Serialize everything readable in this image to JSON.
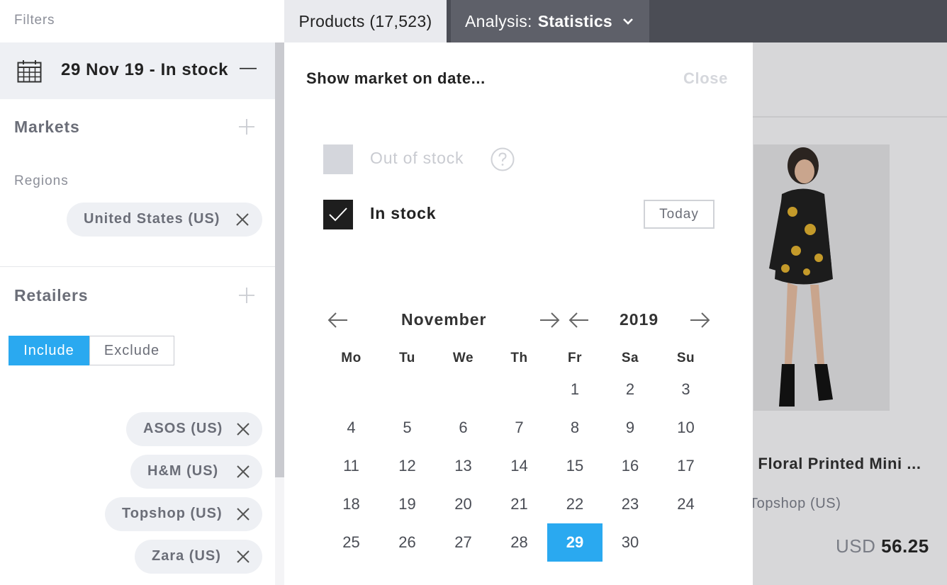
{
  "sidebar": {
    "filters_label": "Filters",
    "date_summary": "29 Nov 19 - In stock",
    "date_collapse": "—",
    "markets": {
      "title": "Markets",
      "regions_label": "Regions",
      "regions": [
        {
          "label": "United States (US)"
        }
      ]
    },
    "retailers": {
      "title": "Retailers",
      "include_label": "Include",
      "exclude_label": "Exclude",
      "mode": "Include",
      "items": [
        {
          "label": "ASOS (US)"
        },
        {
          "label": "H&M (US)"
        },
        {
          "label": "Topshop (US)"
        },
        {
          "label": "Zara (US)"
        }
      ]
    }
  },
  "topbar": {
    "products_tab": "Products (17,523)",
    "analysis_prefix": "Analysis:",
    "analysis_value": "Statistics"
  },
  "popup": {
    "title": "Show market on date...",
    "close_label": "Close",
    "out_of_stock": {
      "label": "Out of stock",
      "checked": false
    },
    "in_stock": {
      "label": "In stock",
      "checked": true
    },
    "today_label": "Today",
    "month": "November",
    "year": "2019",
    "weekdays": [
      "Mo",
      "Tu",
      "We",
      "Th",
      "Fr",
      "Sa",
      "Su"
    ],
    "weeks": [
      [
        "",
        "",
        "",
        "",
        "1",
        "2",
        "3"
      ],
      [
        "4",
        "5",
        "6",
        "7",
        "8",
        "9",
        "10"
      ],
      [
        "11",
        "12",
        "13",
        "14",
        "15",
        "16",
        "17"
      ],
      [
        "18",
        "19",
        "20",
        "21",
        "22",
        "23",
        "24"
      ],
      [
        "25",
        "26",
        "27",
        "28",
        "29",
        "30",
        ""
      ]
    ],
    "selected_day": "29",
    "accent_color": "#2aa9f0"
  },
  "product": {
    "title": ". Floral Printed Mini ...",
    "retailer": "Topshop (US)",
    "currency": "USD",
    "price": "56.25"
  }
}
